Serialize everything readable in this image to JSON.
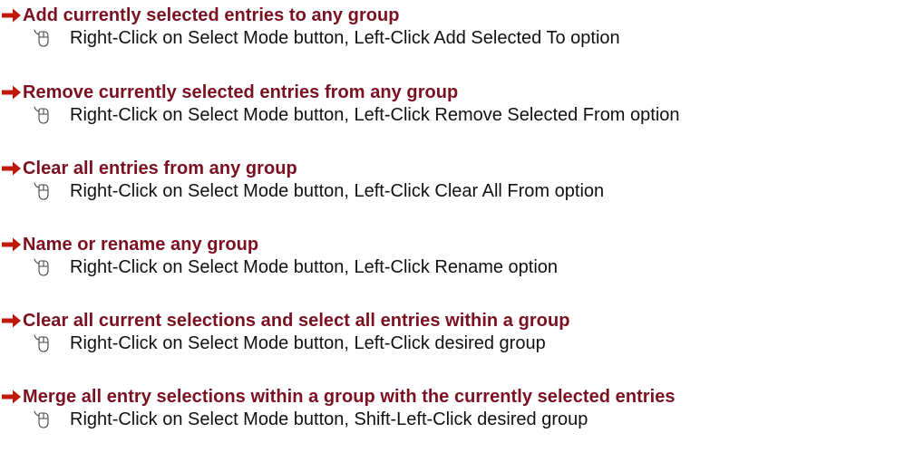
{
  "colors": {
    "heading": "#7a1020",
    "arrow": "#c0180a",
    "body_text": "#111111"
  },
  "icons": {
    "heading_bullet": "right-arrow-icon",
    "step_bullet": "mouse-icon"
  },
  "items": [
    {
      "heading": "Add currently selected entries to any group",
      "step": "Right-Click on Select Mode button, Left-Click Add Selected To option"
    },
    {
      "heading": "Remove currently selected entries from any group",
      "step": "Right-Click on Select Mode button, Left-Click Remove Selected From option"
    },
    {
      "heading": "Clear all entries from any group",
      "step": "Right-Click on Select Mode button, Left-Click Clear All From option"
    },
    {
      "heading": "Name or rename any group",
      "step": "Right-Click on Select Mode button, Left-Click Rename option"
    },
    {
      "heading": "Clear all current selections and select all entries within a group",
      "step": "Right-Click on Select Mode button, Left-Click desired group"
    },
    {
      "heading": "Merge all entry selections within a group with the currently selected entries",
      "step": "Right-Click on Select Mode button, Shift-Left-Click desired group"
    }
  ]
}
